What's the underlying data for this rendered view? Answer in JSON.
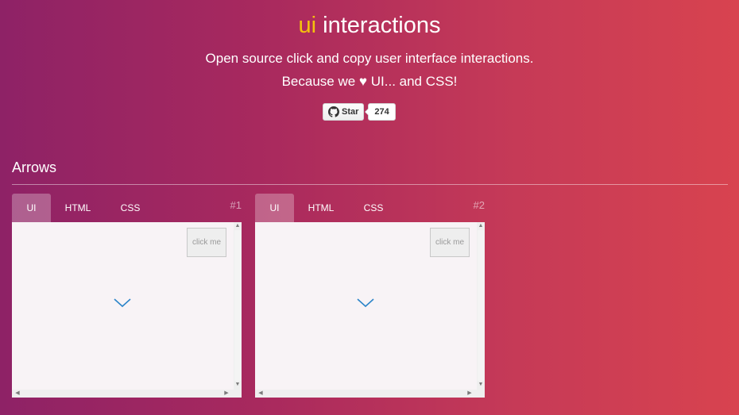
{
  "hero": {
    "title_accent": "ui",
    "title_rest": " interactions",
    "tagline_line1": "Open source click and copy user interface interactions.",
    "tagline_line2": "Because we ♥ UI... and CSS!",
    "github_button": {
      "icon": "github-icon",
      "label": "Star",
      "count": "274"
    }
  },
  "section": {
    "title": "Arrows"
  },
  "cards": [
    {
      "number": "#1",
      "tabs": [
        "UI",
        "HTML",
        "CSS"
      ],
      "active_tab": "UI",
      "button_label": "click me",
      "icon": "chevron-down-icon"
    },
    {
      "number": "#2",
      "tabs": [
        "UI",
        "HTML",
        "CSS"
      ],
      "active_tab": "UI",
      "button_label": "click me",
      "icon": "chevron-down-icon"
    }
  ],
  "colors": {
    "accent": "#f4c20d",
    "arrow": "#2b84c9",
    "gradient_start": "#8e2266",
    "gradient_end": "#d8434f"
  }
}
